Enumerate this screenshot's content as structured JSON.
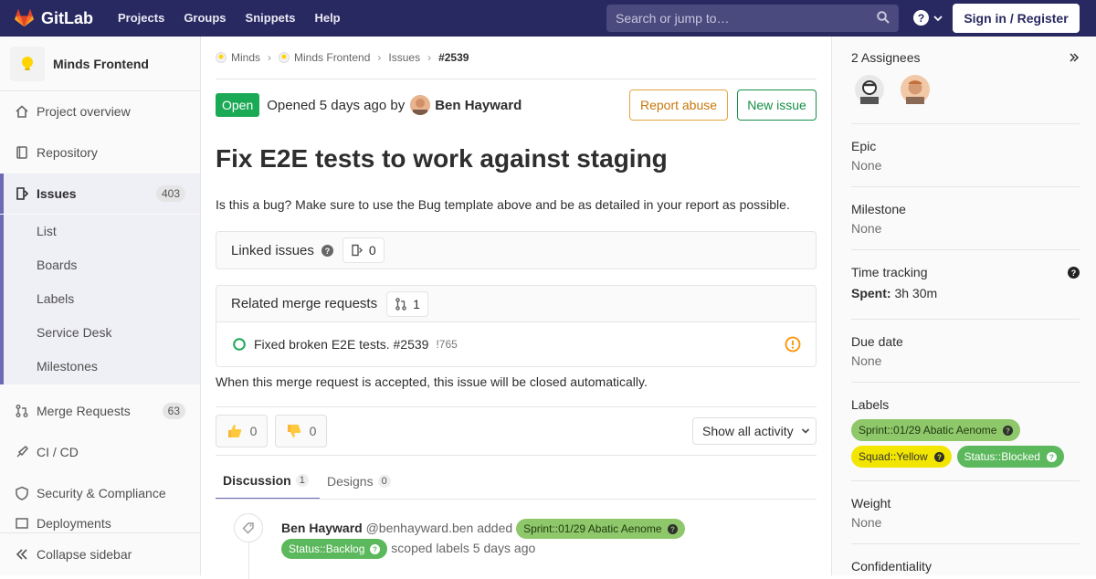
{
  "topbar": {
    "brand": "GitLab",
    "nav": [
      "Projects",
      "Groups",
      "Snippets",
      "Help"
    ],
    "search_placeholder": "Search or jump to…",
    "signin": "Sign in / Register",
    "bg_color": "#292961"
  },
  "sidebar": {
    "project_name": "Minds Frontend",
    "items": {
      "overview": "Project overview",
      "repository": "Repository",
      "issues": "Issues",
      "issues_count": "403",
      "merge_requests": "Merge Requests",
      "mr_count": "63",
      "cicd": "CI / CD",
      "security": "Security & Compliance",
      "partial": "Deployments"
    },
    "issues_sub": [
      "List",
      "Boards",
      "Labels",
      "Service Desk",
      "Milestones"
    ],
    "collapse": "Collapse sidebar"
  },
  "breadcrumb": {
    "group": "Minds",
    "project": "Minds Frontend",
    "section": "Issues",
    "current": "#2539"
  },
  "issue": {
    "status": "Open",
    "opened_text": "Opened 5 days ago by",
    "author": "Ben Hayward",
    "report_abuse": "Report abuse",
    "new_issue": "New issue",
    "title": "Fix E2E tests to work against staging",
    "description": "Is this a bug? Make sure to use the Bug template above and be as detailed in your report as possible."
  },
  "linked_issues": {
    "label": "Linked issues",
    "count": "0"
  },
  "related_mrs": {
    "label": "Related merge requests",
    "count": "1",
    "mr_title": "Fixed broken E2E tests. #2539",
    "mr_ref": "!765",
    "note": "When this merge request is accepted, this issue will be closed automatically."
  },
  "reactions": {
    "thumbs_up": "0",
    "thumbs_down": "0",
    "activity_filter": "Show all activity"
  },
  "tabs": {
    "discussion": "Discussion",
    "discussion_count": "1",
    "designs": "Designs",
    "designs_count": "0"
  },
  "activity": {
    "author": "Ben Hayward",
    "handle": "@benhayward.ben",
    "action": "added",
    "label1": "Sprint::01/29 Abatic Aenome",
    "label2": "Status::Backlog",
    "suffix": "scoped labels 5 days ago"
  },
  "right_sidebar": {
    "assignees": "2 Assignees",
    "epic_title": "Epic",
    "epic_value": "None",
    "milestone_title": "Milestone",
    "milestone_value": "None",
    "time_title": "Time tracking",
    "spent_label": "Spent:",
    "spent_value": "3h 30m",
    "due_title": "Due date",
    "due_value": "None",
    "labels_title": "Labels",
    "labels": [
      "Sprint::01/29 Abatic Aenome",
      "Squad::Yellow",
      "Status::Blocked"
    ],
    "weight_title": "Weight",
    "weight_value": "None",
    "confidentiality_title": "Confidentiality"
  },
  "colors": {
    "green_label": "#8fc76b",
    "yellow_label": "#f2e600",
    "status_green": "#5cb85c",
    "accent": "#6b6bb3"
  }
}
